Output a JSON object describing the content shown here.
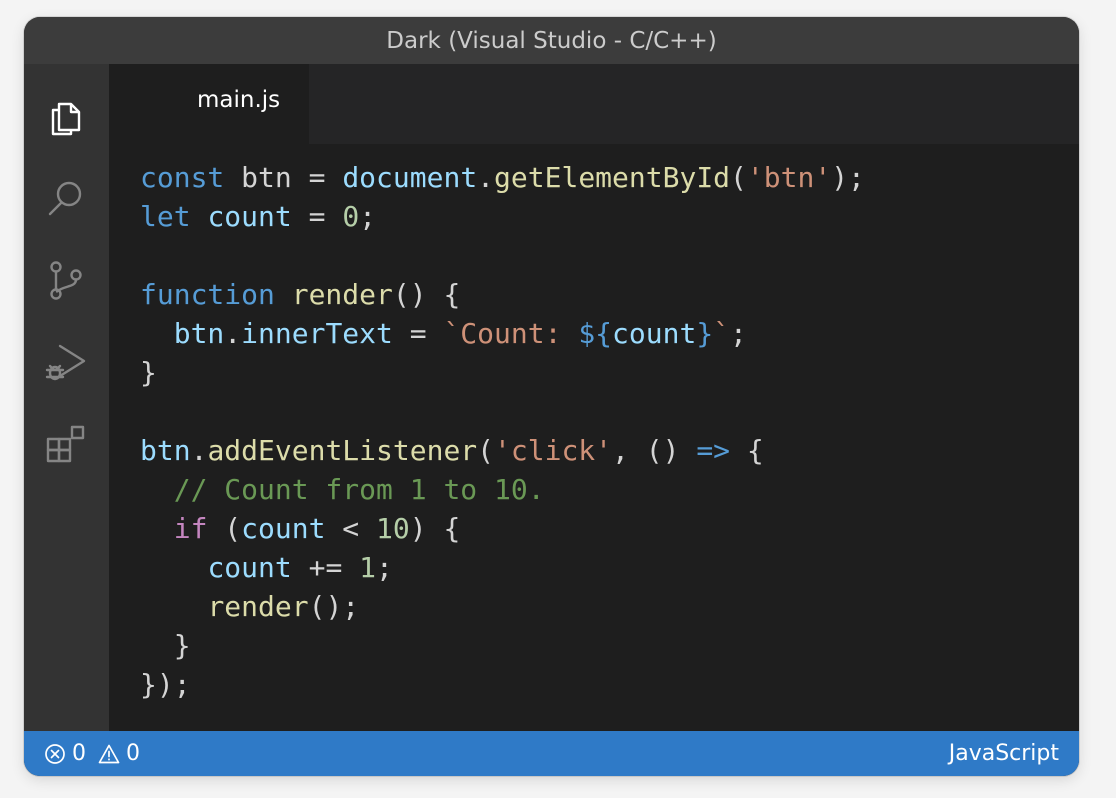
{
  "window": {
    "title": "Dark (Visual Studio - C/C++)"
  },
  "activity_bar": {
    "icons": [
      "explorer-icon",
      "search-icon",
      "source-control-icon",
      "run-debug-icon",
      "extensions-icon"
    ]
  },
  "tabs": [
    {
      "label": "main.js",
      "active": true
    }
  ],
  "editor": {
    "language": "javascript",
    "lines": [
      [
        {
          "t": "const",
          "c": "kw"
        },
        {
          "t": " btn = ",
          "c": "punc"
        },
        {
          "t": "document",
          "c": "var"
        },
        {
          "t": ".",
          "c": "punc"
        },
        {
          "t": "getElementById",
          "c": "fn"
        },
        {
          "t": "(",
          "c": "punc"
        },
        {
          "t": "'btn'",
          "c": "str"
        },
        {
          "t": ");",
          "c": "punc"
        }
      ],
      [
        {
          "t": "let",
          "c": "kw"
        },
        {
          "t": " ",
          "c": "punc"
        },
        {
          "t": "count",
          "c": "var"
        },
        {
          "t": " = ",
          "c": "punc"
        },
        {
          "t": "0",
          "c": "num"
        },
        {
          "t": ";",
          "c": "punc"
        }
      ],
      [],
      [
        {
          "t": "function",
          "c": "kw"
        },
        {
          "t": " ",
          "c": "punc"
        },
        {
          "t": "render",
          "c": "fn"
        },
        {
          "t": "() {",
          "c": "punc"
        }
      ],
      [
        {
          "t": "  ",
          "c": "punc"
        },
        {
          "t": "btn",
          "c": "var"
        },
        {
          "t": ".",
          "c": "punc"
        },
        {
          "t": "innerText",
          "c": "var"
        },
        {
          "t": " = ",
          "c": "punc"
        },
        {
          "t": "`Count: ",
          "c": "str"
        },
        {
          "t": "${",
          "c": "kw"
        },
        {
          "t": "count",
          "c": "var"
        },
        {
          "t": "}",
          "c": "kw"
        },
        {
          "t": "`",
          "c": "str"
        },
        {
          "t": ";",
          "c": "punc"
        }
      ],
      [
        {
          "t": "}",
          "c": "punc"
        }
      ],
      [],
      [
        {
          "t": "btn",
          "c": "var"
        },
        {
          "t": ".",
          "c": "punc"
        },
        {
          "t": "addEventListener",
          "c": "fn"
        },
        {
          "t": "(",
          "c": "punc"
        },
        {
          "t": "'click'",
          "c": "str"
        },
        {
          "t": ", () ",
          "c": "punc"
        },
        {
          "t": "=>",
          "c": "kw"
        },
        {
          "t": " {",
          "c": "punc"
        }
      ],
      [
        {
          "t": "  ",
          "c": "punc"
        },
        {
          "t": "// Count from 1 to 10.",
          "c": "cmt"
        }
      ],
      [
        {
          "t": "  ",
          "c": "punc"
        },
        {
          "t": "if",
          "c": "ctl"
        },
        {
          "t": " (",
          "c": "punc"
        },
        {
          "t": "count",
          "c": "var"
        },
        {
          "t": " < ",
          "c": "punc"
        },
        {
          "t": "10",
          "c": "num"
        },
        {
          "t": ") {",
          "c": "punc"
        }
      ],
      [
        {
          "t": "    ",
          "c": "punc"
        },
        {
          "t": "count",
          "c": "var"
        },
        {
          "t": " += ",
          "c": "punc"
        },
        {
          "t": "1",
          "c": "num"
        },
        {
          "t": ";",
          "c": "punc"
        }
      ],
      [
        {
          "t": "    ",
          "c": "punc"
        },
        {
          "t": "render",
          "c": "fn"
        },
        {
          "t": "();",
          "c": "punc"
        }
      ],
      [
        {
          "t": "  }",
          "c": "punc"
        }
      ],
      [
        {
          "t": "});",
          "c": "punc"
        }
      ]
    ]
  },
  "status_bar": {
    "errors": "0",
    "warnings": "0",
    "language_mode": "JavaScript"
  },
  "colors": {
    "titlebar": "#3c3c3c",
    "activity_bar": "#333333",
    "editor_bg": "#1e1e1e",
    "tab_strip": "#252526",
    "status_bar": "#2f7ac7"
  }
}
